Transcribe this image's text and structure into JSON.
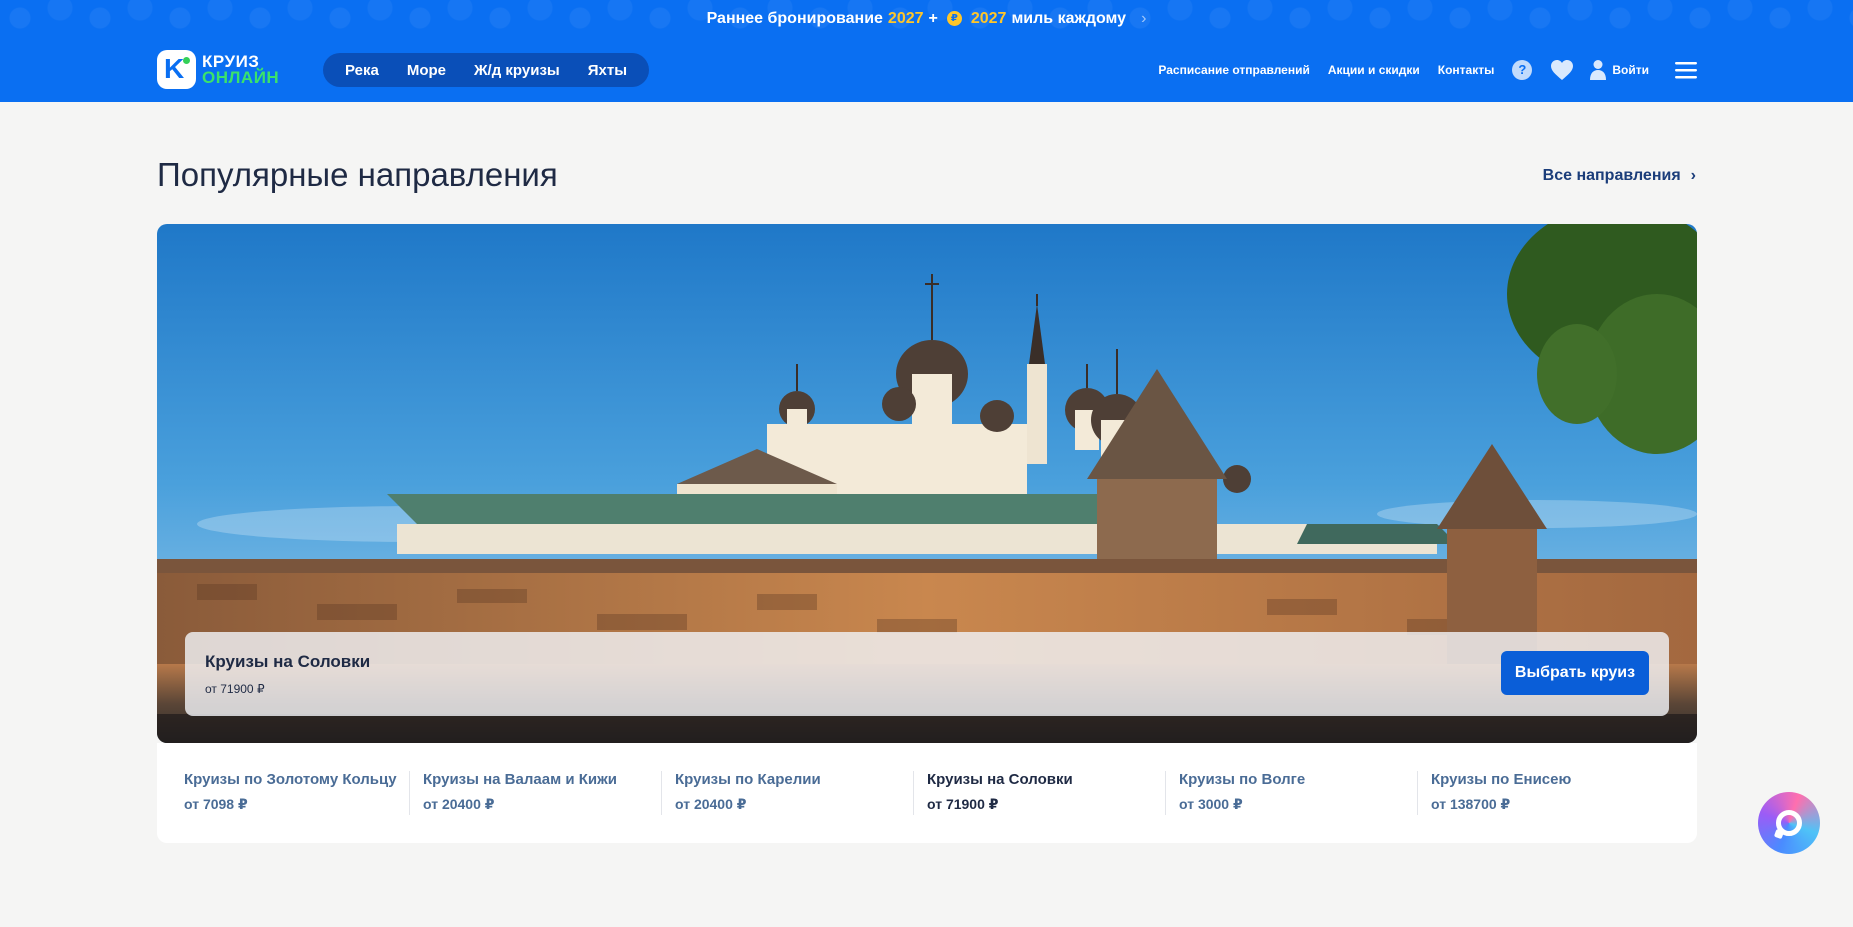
{
  "promo": {
    "text_before": "Раннее бронирование",
    "year_1": "2027",
    "plus": "+",
    "coin": "₽",
    "year_2": "2027",
    "text_after": "миль каждому",
    "chevron": "›"
  },
  "header": {
    "logo_line1": "КРУИЗ",
    "logo_line2": "ОНЛАЙН",
    "logo_mark": "K",
    "modes": [
      "Река",
      "Море",
      "Ж/д круизы",
      "Яхты"
    ],
    "links": [
      "Расписание отправлений",
      "Акции и скидки",
      "Контакты"
    ],
    "help": "?",
    "login": "Войти"
  },
  "section": {
    "title": "Популярные направления",
    "all_link": "Все направления",
    "all_chevron": "›"
  },
  "hero": {
    "title": "Круизы на Соловки",
    "price": "от 71900 ₽",
    "button": "Выбрать круиз"
  },
  "destinations": [
    {
      "name": "Круизы по Золотому Кольцу",
      "price": "от 7098 ₽",
      "active": false
    },
    {
      "name": "Круизы на Валаам и Кижи",
      "price": "от 20400 ₽",
      "active": false
    },
    {
      "name": "Круизы по Карелии",
      "price": "от 20400 ₽",
      "active": false
    },
    {
      "name": "Круизы на Соловки",
      "price": "от 71900 ₽",
      "active": true
    },
    {
      "name": "Круизы по Волге",
      "price": "от 3000 ₽",
      "active": false
    },
    {
      "name": "Круизы по Енисею",
      "price": "от 138700 ₽",
      "active": false
    }
  ],
  "colors": {
    "brand_blue": "#0a6ff2",
    "accent_yellow": "#ffc629",
    "accent_green": "#3be26b",
    "button_blue": "#0a5ed8"
  },
  "icons": [
    "help-icon",
    "heart-icon",
    "user-icon",
    "burger-menu-icon",
    "chat-icon"
  ]
}
